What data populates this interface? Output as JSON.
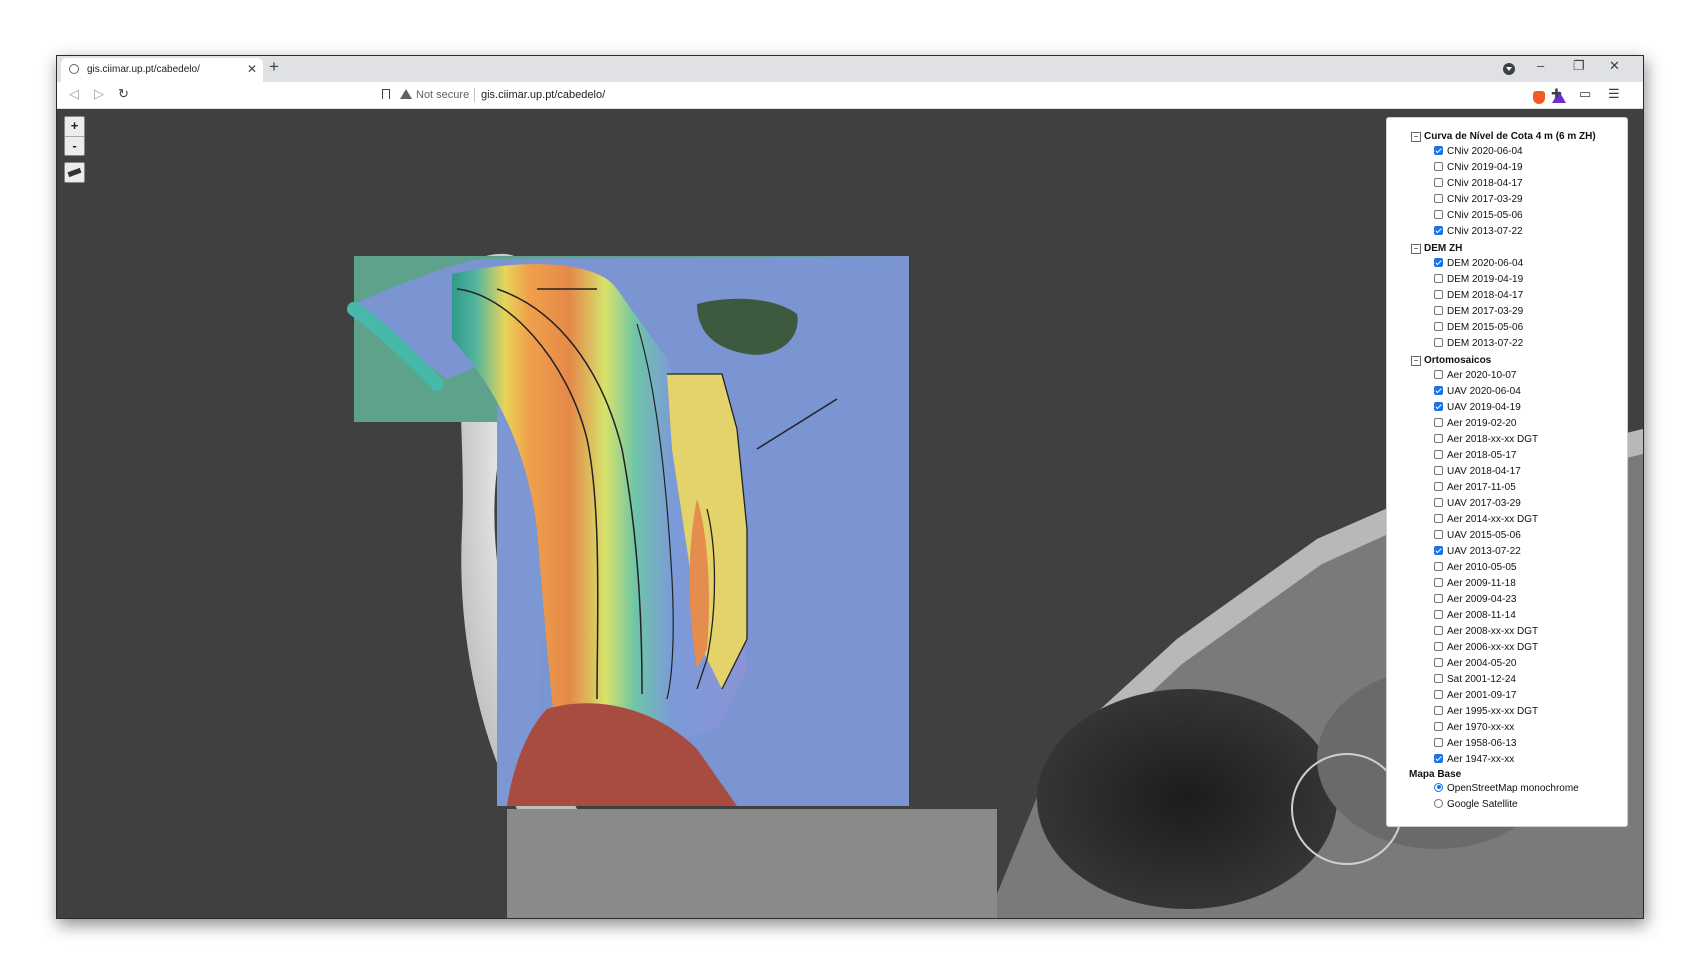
{
  "browser": {
    "tab_title": "gis.ciimar.up.pt/cabedelo/",
    "security_label": "Not secure",
    "url": "gis.ciimar.up.pt/cabedelo/"
  },
  "map": {
    "zoom_in_label": "+",
    "zoom_out_label": "-"
  },
  "layers": {
    "groups": [
      {
        "title": "Curva de Nível de Cota 4 m (6 m ZH)",
        "items": [
          {
            "label": "CNiv 2020-06-04",
            "checked": true
          },
          {
            "label": "CNiv 2019-04-19",
            "checked": false
          },
          {
            "label": "CNiv 2018-04-17",
            "checked": false
          },
          {
            "label": "CNiv 2017-03-29",
            "checked": false
          },
          {
            "label": "CNiv 2015-05-06",
            "checked": false
          },
          {
            "label": "CNiv 2013-07-22",
            "checked": true
          }
        ]
      },
      {
        "title": "DEM ZH",
        "items": [
          {
            "label": "DEM 2020-06-04",
            "checked": true
          },
          {
            "label": "DEM 2019-04-19",
            "checked": false
          },
          {
            "label": "DEM 2018-04-17",
            "checked": false
          },
          {
            "label": "DEM 2017-03-29",
            "checked": false
          },
          {
            "label": "DEM 2015-05-06",
            "checked": false
          },
          {
            "label": "DEM 2013-07-22",
            "checked": false
          }
        ]
      },
      {
        "title": "Ortomosaicos",
        "items": [
          {
            "label": "Aer 2020-10-07",
            "checked": false
          },
          {
            "label": "UAV 2020-06-04",
            "checked": true
          },
          {
            "label": "UAV 2019-04-19",
            "checked": true
          },
          {
            "label": "Aer 2019-02-20",
            "checked": false
          },
          {
            "label": "Aer 2018-xx-xx DGT",
            "checked": false
          },
          {
            "label": "Aer 2018-05-17",
            "checked": false
          },
          {
            "label": "UAV 2018-04-17",
            "checked": false
          },
          {
            "label": "Aer 2017-11-05",
            "checked": false
          },
          {
            "label": "UAV 2017-03-29",
            "checked": false
          },
          {
            "label": "Aer 2014-xx-xx DGT",
            "checked": false
          },
          {
            "label": "UAV 2015-05-06",
            "checked": false
          },
          {
            "label": "UAV 2013-07-22",
            "checked": true
          },
          {
            "label": "Aer 2010-05-05",
            "checked": false
          },
          {
            "label": "Aer 2009-11-18",
            "checked": false
          },
          {
            "label": "Aer 2009-04-23",
            "checked": false
          },
          {
            "label": "Aer 2008-11-14",
            "checked": false
          },
          {
            "label": "Aer 2008-xx-xx DGT",
            "checked": false
          },
          {
            "label": "Aer 2006-xx-xx DGT",
            "checked": false
          },
          {
            "label": "Aer 2004-05-20",
            "checked": false
          },
          {
            "label": "Sat 2001-12-24",
            "checked": false
          },
          {
            "label": "Aer 2001-09-17",
            "checked": false
          },
          {
            "label": "Aer 1995-xx-xx DGT",
            "checked": false
          },
          {
            "label": "Aer 1970-xx-xx",
            "checked": false
          },
          {
            "label": "Aer 1958-06-13",
            "checked": false
          },
          {
            "label": "Aer 1947-xx-xx",
            "checked": true
          }
        ]
      }
    ],
    "base": {
      "title": "Mapa Base",
      "options": [
        {
          "label": "OpenStreetMap monochrome",
          "selected": true
        },
        {
          "label": "Google Satellite",
          "selected": false
        }
      ]
    }
  }
}
